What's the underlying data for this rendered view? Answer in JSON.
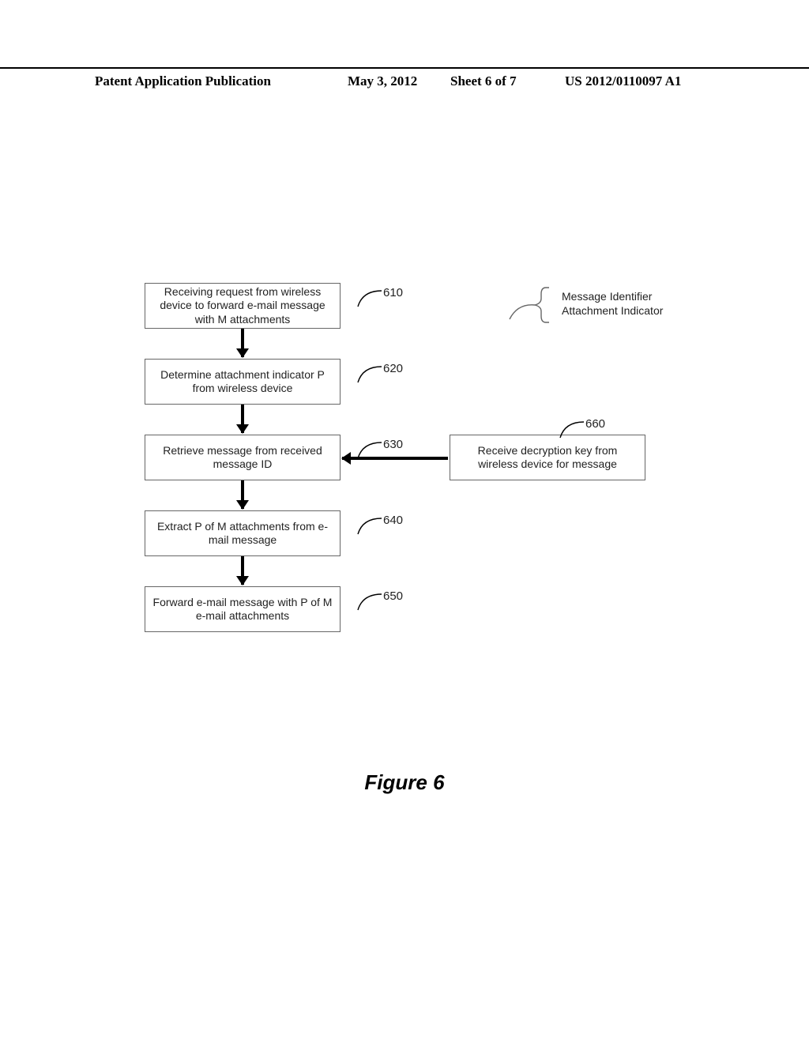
{
  "header": {
    "left": "Patent Application Publication",
    "date": "May 3, 2012",
    "sheet": "Sheet 6 of 7",
    "pubno": "US 2012/0110097 A1"
  },
  "boxes": {
    "b610": "Receiving request from wireless device to forward e-mail message with M attachments",
    "b620": "Determine attachment indicator P from wireless device",
    "b630": "Retrieve message from received message ID",
    "b640": "Extract P of M attachments from e-mail message",
    "b650": "Forward e-mail message with P of M e-mail attachments",
    "b660": "Receive decryption key from wireless device for message"
  },
  "refs": {
    "r610": "610",
    "r620": "620",
    "r630": "630",
    "r640": "640",
    "r650": "650",
    "r660": "660"
  },
  "annotation": {
    "line1": "Message Identifier",
    "line2": "Attachment Indicator"
  },
  "caption": "Figure 6"
}
